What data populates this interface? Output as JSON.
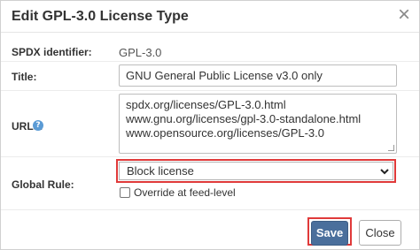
{
  "dialog": {
    "title": "Edit GPL-3.0 License Type",
    "close_glyph": "×"
  },
  "form": {
    "spdx": {
      "label": "SPDX identifier:",
      "value": "GPL-3.0"
    },
    "title": {
      "label": "Title:",
      "value": "GNU General Public License v3.0 only"
    },
    "urls": {
      "label": "URLs:",
      "help_icon": "question-circle-icon",
      "lines": [
        "spdx.org/licenses/GPL-3.0.html",
        "www.gnu.org/licenses/gpl-3.0-standalone.html",
        "www.opensource.org/licenses/GPL-3.0"
      ]
    },
    "global_rule": {
      "label": "Global Rule:",
      "selected": "Block license"
    },
    "override": {
      "label": "Override at feed-level",
      "checked": false
    }
  },
  "footer": {
    "save_label": "Save",
    "close_label": "Close"
  },
  "colors": {
    "highlight": "#e03a3a",
    "primary_button": "#4a6f9c",
    "help_icon": "#5b9bd5"
  }
}
